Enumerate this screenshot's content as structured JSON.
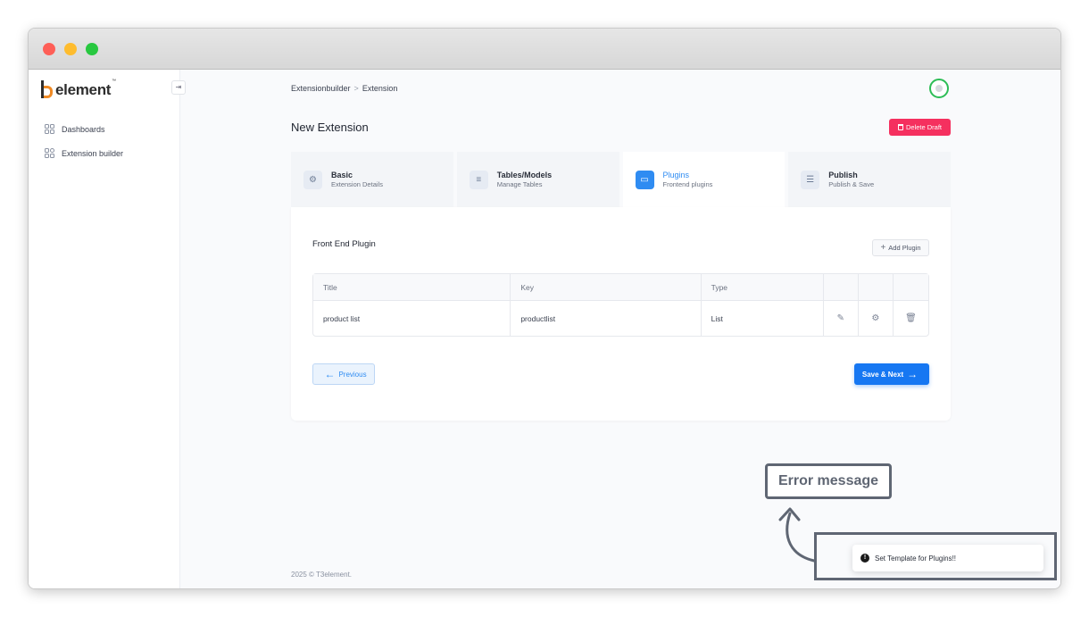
{
  "brand": {
    "logo_text": "element",
    "logo_tm": "™",
    "collapse_icon": "collapse-icon"
  },
  "sidebar": {
    "items": [
      {
        "label": "Dashboards",
        "icon": "dashboard-grid-icon"
      },
      {
        "label": "Extension builder",
        "icon": "extension-grid-icon"
      }
    ]
  },
  "breadcrumb": {
    "items": [
      "Extensionbuilder",
      "Extension"
    ],
    "separator": ">"
  },
  "header": {
    "title": "New Extension",
    "delete_label": "Delete Draft"
  },
  "steps": [
    {
      "title": "Basic",
      "subtitle": "Extension Details",
      "icon": "gear-icon",
      "active": false
    },
    {
      "title": "Tables/Models",
      "subtitle": "Manage Tables",
      "icon": "database-icon",
      "active": false
    },
    {
      "title": "Plugins",
      "subtitle": "Frontend plugins",
      "icon": "window-icon",
      "active": true
    },
    {
      "title": "Publish",
      "subtitle": "Publish & Save",
      "icon": "sliders-icon",
      "active": false
    }
  ],
  "plugins": {
    "section_title": "Front End Plugin",
    "add_label": "Add Plugin",
    "columns": [
      "Title",
      "Key",
      "Type"
    ],
    "rows": [
      {
        "title": "product list",
        "key": "productlist",
        "type": "List"
      }
    ]
  },
  "nav": {
    "previous_label": "Previous",
    "next_label": "Save & Next"
  },
  "footer": {
    "text": "2025 ©  T3element."
  },
  "annotation": {
    "callout_label": "Error message"
  },
  "toast": {
    "message": "Set Template for Plugins!!",
    "icon": "exclamation-icon"
  },
  "colors": {
    "accent": "#1677f2",
    "danger": "#f5305f",
    "logo_orange": "#f08a24",
    "avatar_ring": "#2dbd56"
  }
}
